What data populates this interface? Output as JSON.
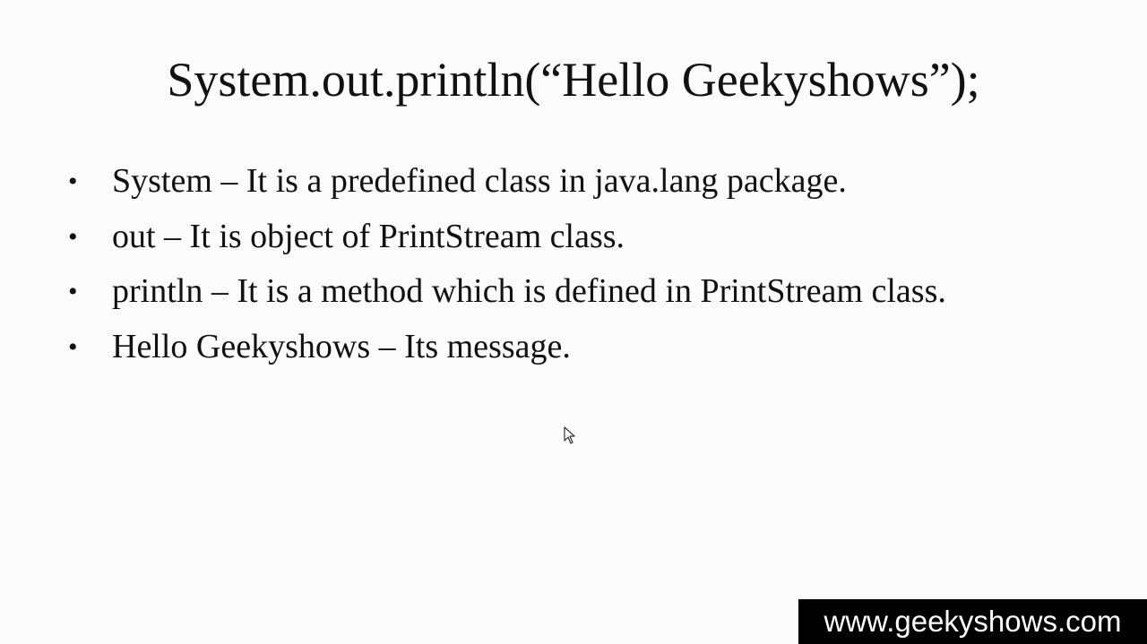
{
  "slide": {
    "title": "System.out.println(“Hello Geekyshows”);",
    "bullets": [
      {
        "marker": "•",
        "text": "System – It is a predefined class in java.lang package."
      },
      {
        "marker": "•",
        "text": "out – It is object of PrintStream class."
      },
      {
        "marker": "•",
        "text": "println – It is a method which is defined in PrintStream class."
      },
      {
        "marker": "•",
        "text": "Hello Geekyshows  – Its message."
      }
    ]
  },
  "watermark": {
    "text": "www.geekyshows.com"
  },
  "icons": {
    "cursor": "mouse-pointer-icon"
  },
  "colors": {
    "background": "#fbfbfb",
    "text": "#111111",
    "watermark_background": "#000000",
    "watermark_text": "#ffffff"
  }
}
